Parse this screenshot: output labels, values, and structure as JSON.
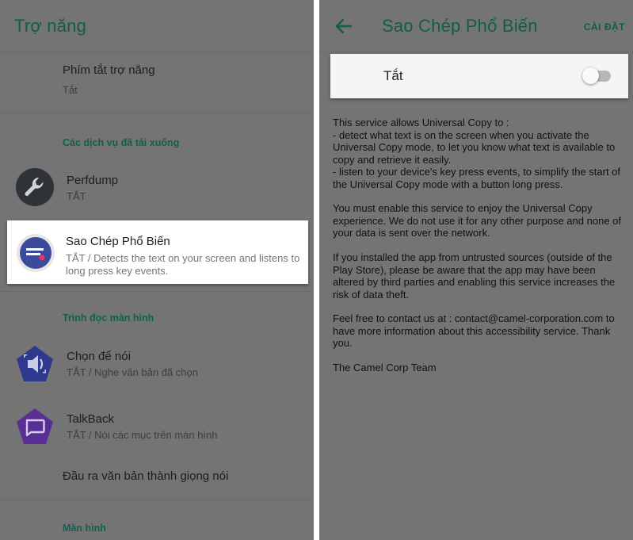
{
  "left": {
    "title": "Trợ năng",
    "shortcut": {
      "title": "Phím tắt trợ năng",
      "status": "Tắt"
    },
    "downloaded_header": "Các dịch vụ đã tải xuống",
    "perfdump": {
      "title": "Perfdump",
      "status": "TẮT"
    },
    "universal_copy": {
      "title": "Sao Chép Phổ Biến",
      "status": "TẮT / Detects the text on your screen and listens to long press key events."
    },
    "screen_reader_header": "Trình đọc màn hình",
    "select_to_speak": {
      "title": "Chọn để nói",
      "status": "TẮT / Nghe văn bản đã chọn"
    },
    "talkback": {
      "title": "TalkBack",
      "status": "TẮT / Nói các mục trên màn hình"
    },
    "tts_output": {
      "title": "Đầu ra văn bản thành giọng nói"
    },
    "display_header": "Màn hình"
  },
  "right": {
    "title": "Sao Chép Phổ Biến",
    "settings_label": "CÀI ĐẶT",
    "toggle": {
      "label": "Tắt",
      "on": false
    },
    "description": [
      "This service allows Universal Copy to :",
      "- detect what text is on the screen when you activate the Universal Copy mode, to let you know what text is available to copy and retrieve it easily.",
      "- listen to your device's key press events, to simplify the start of the Universal Copy mode with a button long press.",
      "You must enable this service to enjoy the Universal Copy experience. We do not use it for any other purpose and none of your data is sent over the network.",
      "If you installed the app from untrusted sources (outside of the Play Store), please be aware that the app may have been altered by third parties and enabling this service increases the risk of data theft.",
      "Feel free to contact us at : contact@camel-corporation.com to have more information about this accessibility service. Thank you.",
      "The Camel Corp Team"
    ]
  },
  "colors": {
    "accent": "#0f5d4c",
    "scrim_background": "#747474",
    "perfdump_icon": "#2f3337",
    "universal_copy_icon": "#3b4a9b",
    "select_to_speak_icon": "#2f3a8e",
    "talkback_icon": "#5a2f95"
  },
  "icons": {
    "back": "arrow-left-icon",
    "perfdump": "wrench-icon",
    "universal_copy": "copy-text-icon",
    "select_to_speak": "speaker-icon",
    "talkback": "speech-bubble-icon"
  }
}
